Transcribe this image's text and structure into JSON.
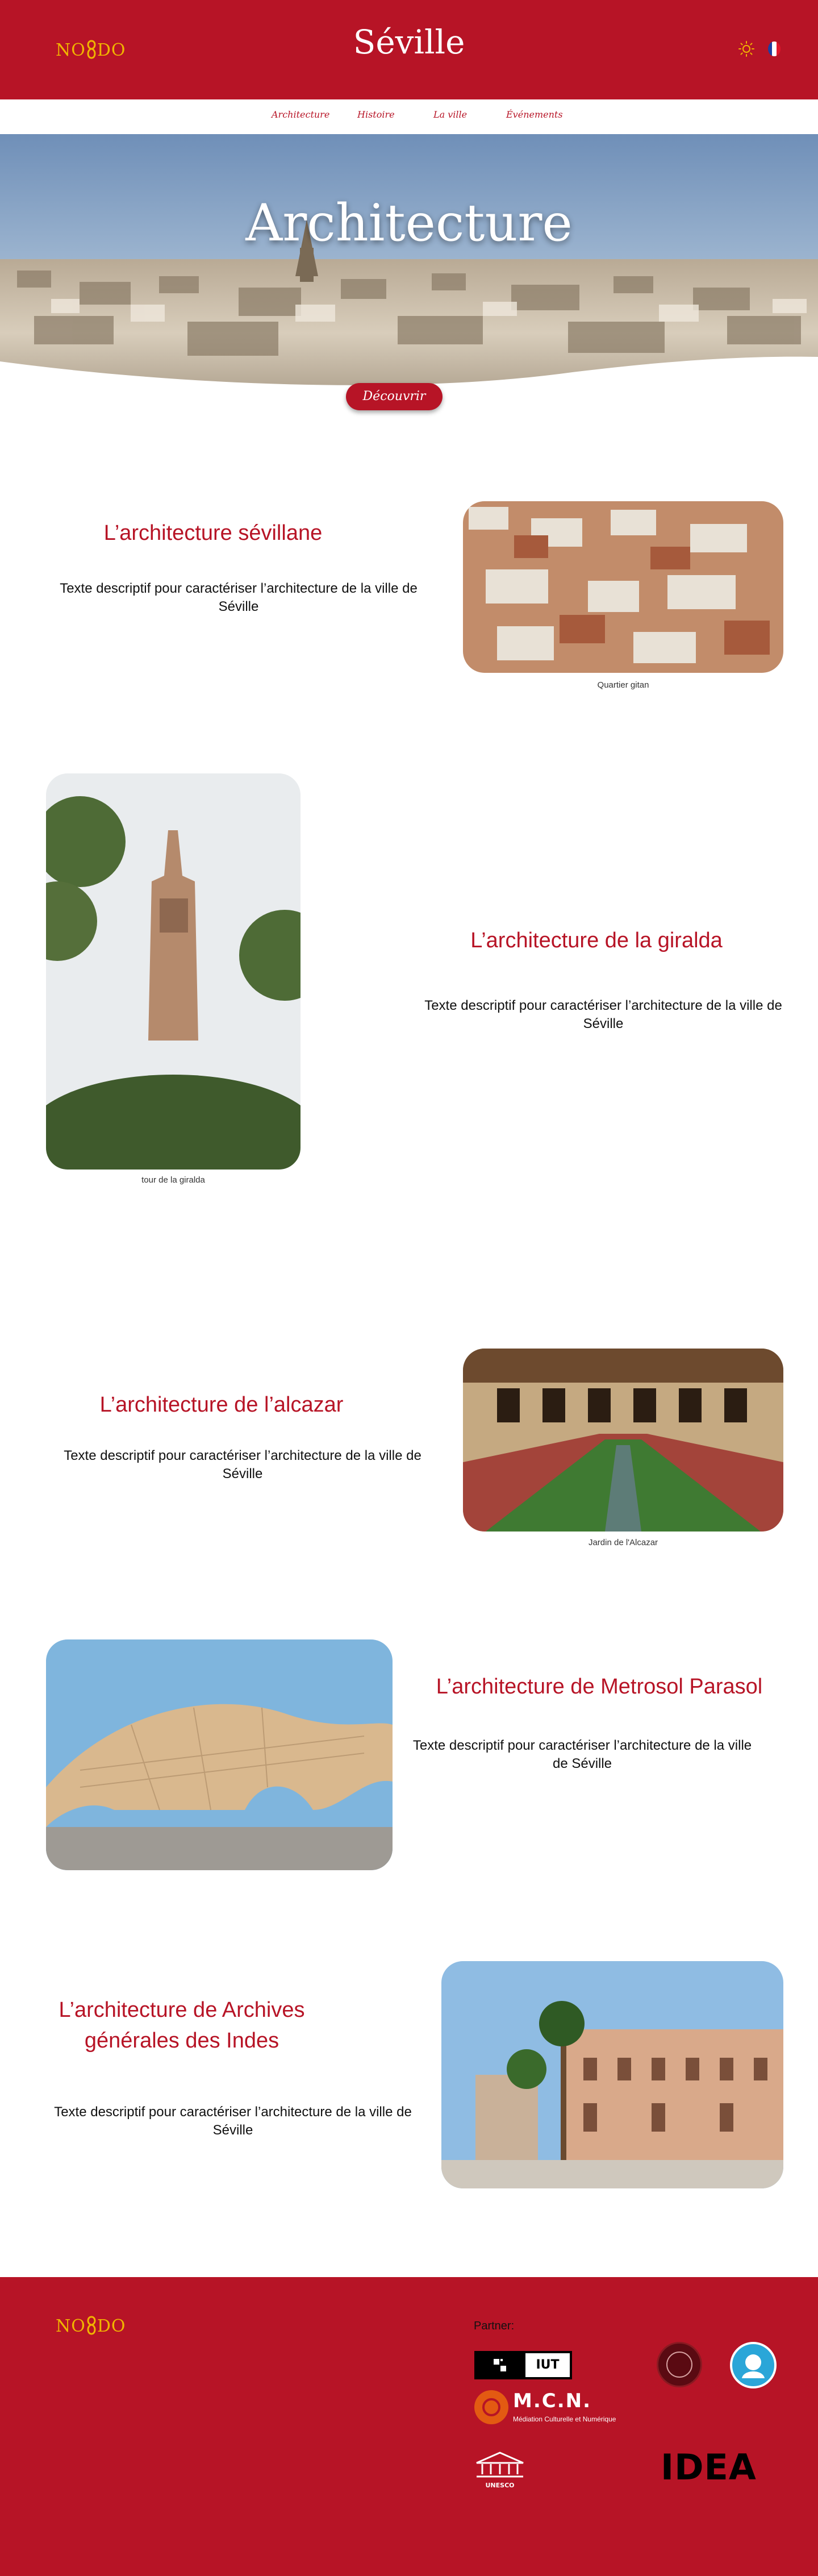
{
  "header": {
    "logo": {
      "left": "NO",
      "right": "DO"
    },
    "title": "Séville",
    "theme_icon": "sun-icon",
    "language_icon": "french-flag-icon"
  },
  "nav": {
    "items": [
      {
        "label": "Architecture"
      },
      {
        "label": "Histoire"
      },
      {
        "label": "La ville"
      },
      {
        "label": "Événements"
      }
    ]
  },
  "hero": {
    "title": "Architecture",
    "button_label": "Découvrir"
  },
  "sections": [
    {
      "title": "L’architecture sévillane",
      "text": "Texte descriptif pour caractériser l’architecture de la ville de Séville",
      "caption": "Quartier gitan"
    },
    {
      "title": "L’architecture de la giralda",
      "text": "Texte descriptif pour caractériser l’architecture de la ville de Séville",
      "caption": "tour de la giralda"
    },
    {
      "title": "L’architecture de l’alcazar",
      "text": "Texte descriptif pour caractériser l’architecture de la ville de Séville",
      "caption": "Jardin de l'Alcazar"
    },
    {
      "title": "L’architecture de Metrosol Parasol",
      "text": "Texte descriptif pour caractériser l’architecture de la ville de Séville",
      "caption": ""
    },
    {
      "title": "L’architecture de Archives générales des Indes",
      "text": "Texte descriptif pour caractériser l’architecture de la ville de Séville",
      "caption": ""
    }
  ],
  "footer": {
    "logo": {
      "left": "NO",
      "right": "DO"
    },
    "partner_label": "Partner:",
    "partners": {
      "iut": "IUT",
      "mcn": "M.C.N.",
      "mcn_subtitle": "Médiation Culturelle et Numérique",
      "unesco": "UNESCO",
      "idea": "IDEA"
    }
  },
  "colors": {
    "brand_red": "#b71426",
    "logo_gold": "#f0b400"
  }
}
